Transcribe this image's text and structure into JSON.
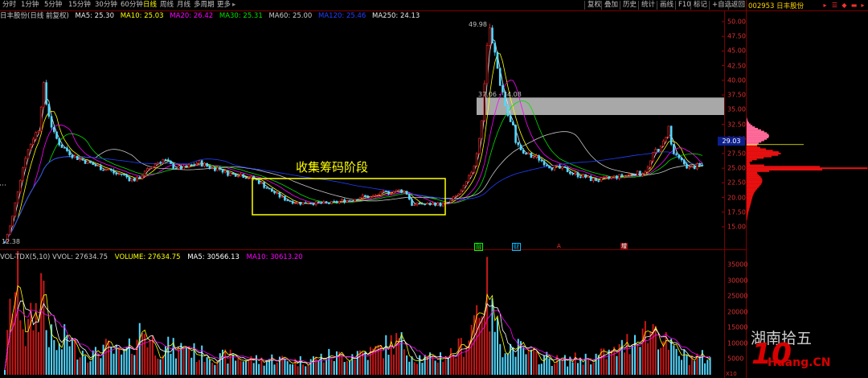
{
  "toolbar": {
    "tabs": [
      "分时",
      "1分钟",
      "5分钟",
      "15分钟",
      "30分钟",
      "60分钟",
      "日线",
      "周线",
      "月线",
      "多周期",
      "更多"
    ],
    "active_tab": "日线",
    "dropdown_glyph": "▸",
    "buttons": [
      "复权",
      "叠加",
      "历史",
      "统计",
      "画线",
      "F10",
      "标记",
      "+自选",
      "返回"
    ]
  },
  "stock": {
    "code_name": "002953 日丰股份",
    "title": "日丰股份(日线 前复权)"
  },
  "ma_line": [
    {
      "text": "MA5: 25.30",
      "color": "#e8e8e8"
    },
    {
      "text": "MA10: 25.03",
      "color": "#ffff00"
    },
    {
      "text": "MA20: 26.42",
      "color": "#ff00ff"
    },
    {
      "text": "MA30: 25.31",
      "color": "#00e000"
    },
    {
      "text": "MA60: 25.00",
      "color": "#c8c8c8"
    },
    {
      "text": "MA120: 25.46",
      "color": "#2040ff"
    },
    {
      "text": "MA250: 24.13",
      "color": "#e8e8e8"
    }
  ],
  "vol_line": [
    {
      "text": "VOL-TDX(5,10) VVOL: 27634.75",
      "color": "#c8c8c8"
    },
    {
      "text": "VOLUME: 27634.75",
      "color": "#ffff00"
    },
    {
      "text": "MA5: 30566.13",
      "color": "#ffffff"
    },
    {
      "text": "MA10: 30613.20",
      "color": "#ff00ff"
    }
  ],
  "price_axis": [
    "50.00",
    "47.50",
    "45.00",
    "42.50",
    "40.00",
    "37.50",
    "35.00",
    "32.50",
    "30.00",
    "27.50",
    "25.00",
    "22.50",
    "20.00",
    "17.50",
    "15.00"
  ],
  "vol_axis": [
    "35000",
    "30000",
    "25000",
    "20000",
    "15000",
    "10000",
    "5000"
  ],
  "vol_unit": "X10",
  "annotations": {
    "high": "49.98",
    "low": "12.38",
    "range": "37.06 - 34.08",
    "box_label": "收集筹码阶段",
    "current_price": "29.03"
  },
  "markers": [
    {
      "text": "融",
      "color": "#00ff00"
    },
    {
      "text": "财",
      "color": "#00bfff"
    },
    {
      "text": "A",
      "color": "#ff3030"
    },
    {
      "text": "增",
      "color": "#ffffff"
    }
  ],
  "watermark": {
    "text": "湖南拾五",
    "logo_number": "10",
    "site": "Huang.CN"
  },
  "colors": {
    "up": "#ff2a2a",
    "down": "#54d8ff",
    "box": "#ffff00",
    "zone": "#a8a8a8"
  },
  "chart_data": [
    {
      "type": "candlestick",
      "title": "日丰股份(日线 前复权)",
      "x": [
        0,
        8,
        16,
        24,
        32,
        40,
        44,
        48,
        56,
        64,
        72,
        80,
        88,
        96,
        104,
        112,
        120,
        128,
        136,
        144,
        152,
        160,
        168,
        176,
        184,
        192,
        200,
        208,
        216,
        224,
        232,
        240,
        248,
        256,
        264,
        272,
        280,
        288,
        296,
        304,
        312,
        320,
        328,
        336,
        344,
        352,
        360,
        368,
        376,
        384,
        392,
        400,
        408,
        416,
        424,
        432,
        440,
        448,
        456,
        464,
        472,
        480,
        488,
        496,
        504,
        512,
        520,
        528,
        536,
        544,
        552,
        556,
        560,
        564,
        568,
        572,
        576,
        580,
        584,
        588,
        592,
        596,
        600,
        604,
        608,
        616,
        624,
        632,
        640,
        648,
        656,
        664,
        672,
        680,
        688,
        696,
        704,
        712,
        720,
        728,
        736,
        744,
        752,
        760,
        768,
        772,
        776,
        780,
        784,
        792,
        800,
        808,
        816,
        822
      ],
      "close": [
        12.4,
        16,
        22,
        27,
        30,
        32,
        40,
        36,
        31,
        29,
        28,
        27,
        26.5,
        26,
        25.5,
        25,
        24.8,
        24,
        24,
        23.2,
        23,
        24,
        25,
        26,
        26.5,
        25.5,
        25,
        25,
        25.5,
        26,
        25.5,
        25,
        25,
        24.2,
        24,
        24,
        23.5,
        23.2,
        22.5,
        21.5,
        20.8,
        20,
        19.5,
        19.2,
        19,
        19.2,
        19,
        19,
        19,
        19.2,
        19.5,
        19.5,
        20,
        20.2,
        20,
        20.5,
        20.8,
        21,
        21.2,
        21,
        18.5,
        19,
        18.8,
        19,
        18.8,
        19,
        20,
        21,
        23,
        26,
        33,
        42,
        49.98,
        46,
        44,
        40,
        38,
        35,
        33,
        32,
        29,
        28.5,
        27.2,
        27.5,
        27,
        26.8,
        26,
        25.2,
        25,
        24.8,
        24.2,
        23.8,
        23.5,
        23,
        23,
        23.2,
        23.5,
        23.6,
        23.8,
        24.2,
        24,
        25,
        28,
        28.5,
        32,
        28,
        27,
        26.5,
        26,
        25,
        25.3,
        25.5
      ],
      "y_axis_range": [
        15,
        50
      ]
    },
    {
      "type": "bar",
      "title": "VOL-TDX(5,10)",
      "values": [
        2000,
        25000,
        28000,
        12000,
        18000,
        22000,
        35000,
        15000,
        10000,
        8000,
        13000,
        9000,
        8000,
        7000,
        6000,
        9000,
        8000,
        7000,
        6000,
        8000,
        12000,
        15000,
        11000,
        9000,
        8000,
        9000,
        7000,
        10000,
        8000,
        6000,
        7000,
        6000,
        5000,
        6000,
        5500,
        5000,
        5000,
        4800,
        4500,
        5000,
        5200,
        4800,
        4500,
        4200,
        4500,
        5000,
        5000,
        5500,
        6000,
        5800,
        6200,
        6500,
        7000,
        7200,
        7000,
        8000,
        9000,
        10000,
        10500,
        9000,
        6000,
        5500,
        5000,
        5000,
        6000,
        6500,
        7000,
        9000,
        12000,
        20000,
        25000,
        30000,
        22000,
        18000,
        15000,
        12000,
        10000,
        10000,
        9000,
        8000,
        9000,
        8000,
        7000,
        7000,
        6000,
        6000,
        5500,
        5000,
        4500,
        4500,
        5000,
        5000,
        5200,
        5500,
        6000,
        6500,
        7000,
        8000,
        10000,
        12000,
        15000,
        13000,
        16000,
        11000,
        9000,
        8000,
        7000,
        6500,
        6000,
        5500,
        5500,
        5500,
        6000
      ],
      "y_axis_range": [
        0,
        38000
      ],
      "unit": "X10"
    }
  ]
}
